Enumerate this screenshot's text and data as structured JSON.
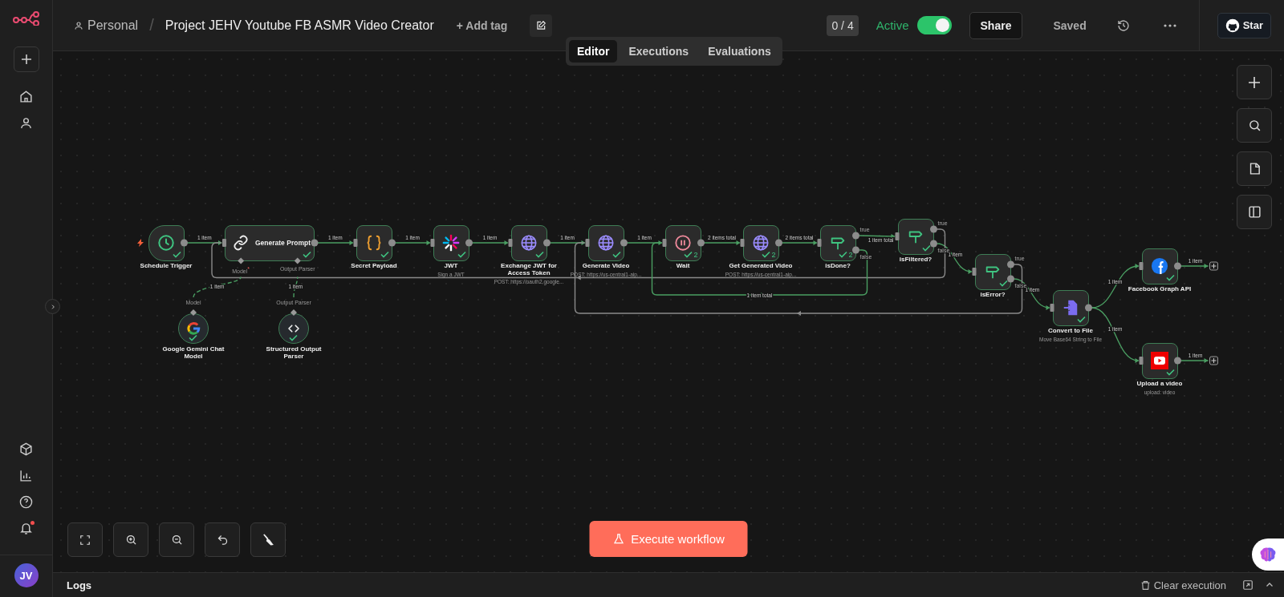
{
  "sidebar": {
    "avatar": "JV",
    "unread": true
  },
  "header": {
    "breadcrumb": "Personal",
    "separator": "/",
    "title": "Project JEHV Youtube FB ASMR Video Creator",
    "add_tag": "+ Add tag",
    "counter": "0 / 4",
    "active_label": "Active",
    "active": true,
    "share": "Share",
    "status": "Saved",
    "star": "Star"
  },
  "tabs": [
    {
      "label": "Editor",
      "selected": true
    },
    {
      "label": "Executions",
      "selected": false
    },
    {
      "label": "Evaluations",
      "selected": false
    }
  ],
  "nodes": [
    {
      "name": "Schedule Trigger",
      "kind": "trigger",
      "success": true
    },
    {
      "name": "Generate Prompt",
      "kind": "agent",
      "success": true,
      "slots": [
        "Model$^{*}$",
        "Output Parser"
      ]
    },
    {
      "name": "Secret Payload",
      "kind": "regular",
      "success": true
    },
    {
      "name": "JWT",
      "subtitle": "Sign a JWT",
      "kind": "regular",
      "success": true
    },
    {
      "name": "Exchange JWT for Access Token",
      "subtitle": "POST: https://oauth2.google...",
      "kind": "regular",
      "success": true
    },
    {
      "name": "Generate Video",
      "subtitle": "POST: https://us-central1-aip...",
      "kind": "regular",
      "success": true
    },
    {
      "name": "Wait",
      "kind": "regular",
      "success": true,
      "runs": "2"
    },
    {
      "name": "Get Generated Video",
      "subtitle": "POST: https://us-central1-aip...",
      "kind": "regular",
      "success": true,
      "runs": "2"
    },
    {
      "name": "isDone?",
      "kind": "if",
      "success": true,
      "runs": "2",
      "outputs": [
        "true",
        "false"
      ]
    },
    {
      "name": "isFiltered?",
      "kind": "if",
      "success": true,
      "outputs": [
        "true",
        "false"
      ]
    },
    {
      "name": "isError?",
      "kind": "if",
      "success": true,
      "outputs": [
        "true",
        "false"
      ]
    },
    {
      "name": "Convert to File",
      "subtitle": "Move Base64 String to File",
      "kind": "regular",
      "success": true
    },
    {
      "name": "Facebook Graph API",
      "kind": "regular",
      "success": true
    },
    {
      "name": "Upload a video",
      "subtitle": "upload: video",
      "kind": "regular",
      "success": true
    },
    {
      "name": "Google Gemini Chat Model",
      "kind": "sub",
      "success": true,
      "slot": "Model"
    },
    {
      "name": "Structured Output Parser",
      "kind": "sub",
      "success": true,
      "slot": "Output Parser"
    }
  ],
  "connections": [
    {
      "label": "1 item",
      "executed": true
    },
    {
      "label": "1 item",
      "executed": true
    },
    {
      "label": "1 item",
      "executed": true
    },
    {
      "label": "1 item",
      "executed": true
    },
    {
      "label": "1 item",
      "executed": true
    },
    {
      "label": "1 item",
      "executed": true
    },
    {
      "label": "2 items total",
      "executed": true
    },
    {
      "label": "2 items total",
      "executed": true
    },
    {
      "label": "1 item total",
      "executed": true
    },
    {
      "label": "1 item",
      "executed": true
    },
    {
      "label": "1 item",
      "executed": true
    },
    {
      "label": "1 item",
      "executed": true
    },
    {
      "label": "1 item",
      "executed": true
    },
    {
      "executed": false
    },
    {
      "label": "1 item total",
      "executed": true
    },
    {
      "executed": false
    },
    {
      "label": "1 item",
      "executed": true
    },
    {
      "label": "1 item",
      "executed": true
    },
    {
      "label": "1 item",
      "executed": true
    },
    {
      "label": "1 item",
      "executed": true
    }
  ],
  "execute_button": "Execute workflow",
  "logs": {
    "title": "Logs",
    "clear": "Clear execution"
  }
}
